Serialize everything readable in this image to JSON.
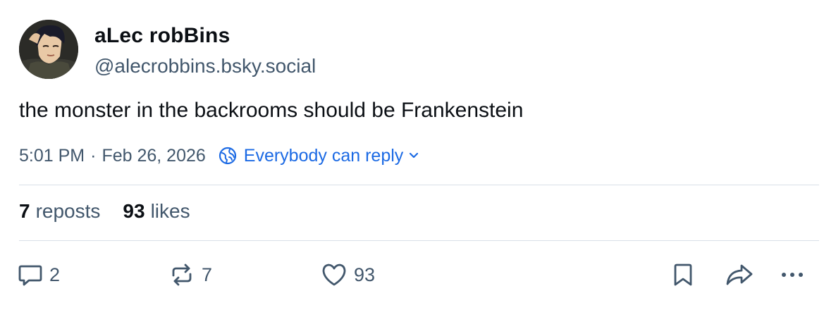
{
  "author": {
    "display_name": "aLec robBins",
    "handle": "@alecrobbins.bsky.social",
    "avatar_icon": "avatar-anime-portrait"
  },
  "post": {
    "text": "the monster in the backrooms should be Frankenstein",
    "time": "5:01 PM",
    "separator": "·",
    "date": "Feb 26, 2026",
    "reply_setting": "Everybody can reply"
  },
  "stats": {
    "reposts_count": "7",
    "reposts_label": "reposts",
    "likes_count": "93",
    "likes_label": "likes"
  },
  "actions": {
    "reply_count": "2",
    "repost_count": "7",
    "like_count": "93"
  },
  "colors": {
    "text": "#0b0f14",
    "muted": "#42576c",
    "accent": "#1c6ae4",
    "divider": "#d9e0e8"
  }
}
